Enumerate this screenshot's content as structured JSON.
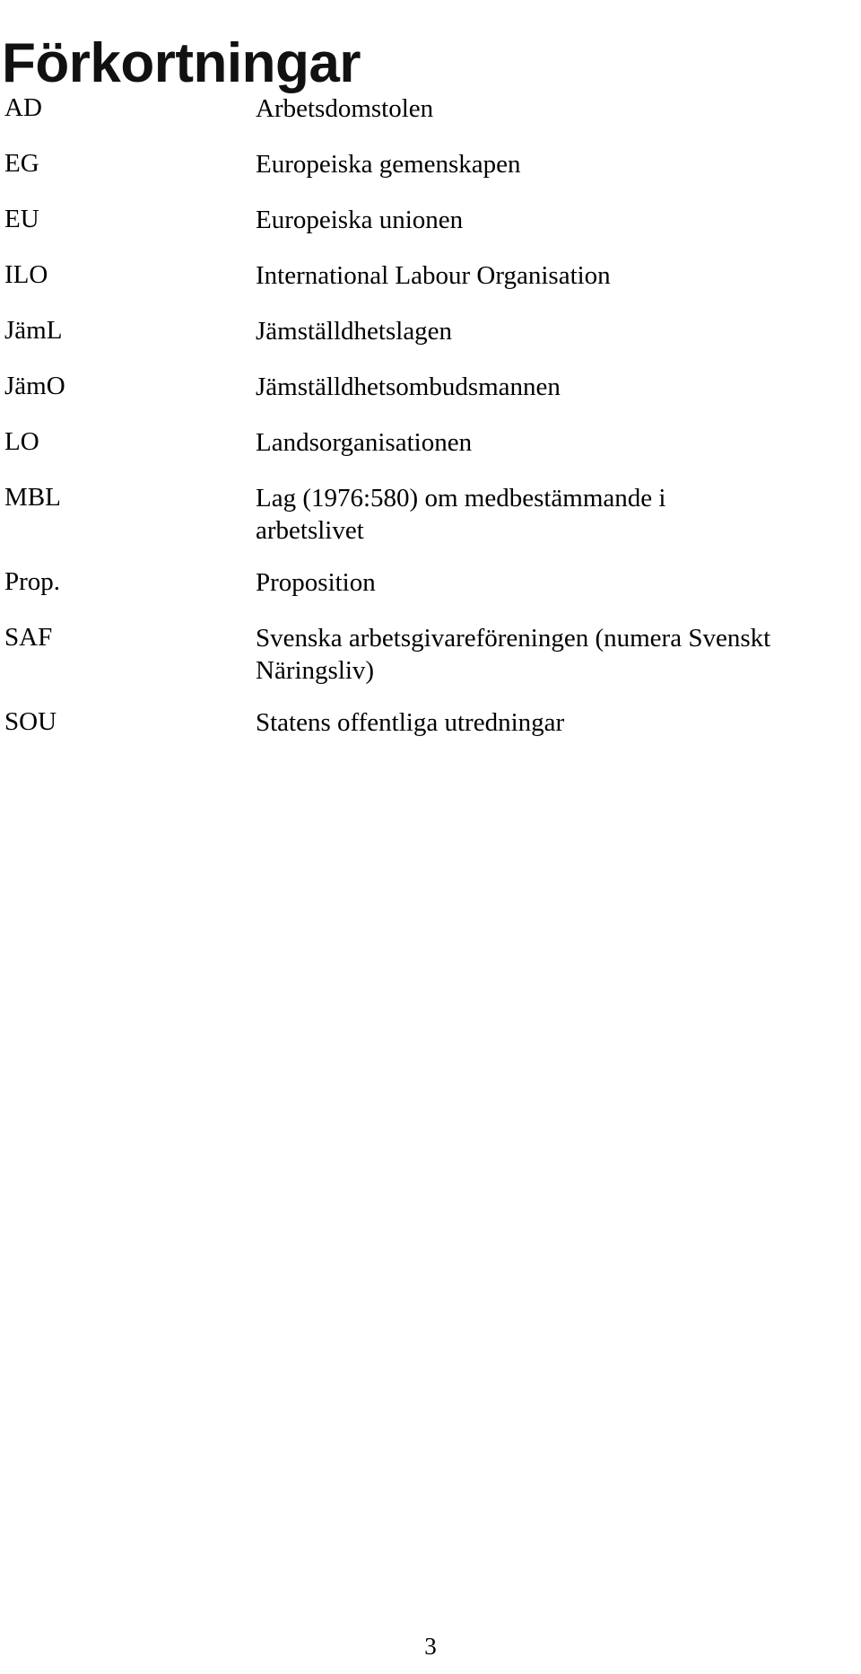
{
  "document": {
    "title": "Förkortningar",
    "page_number": "3"
  },
  "abbreviations": [
    {
      "term": "AD",
      "definition_lines": [
        "Arbetsdomstolen"
      ]
    },
    {
      "term": "EG",
      "definition_lines": [
        "Europeiska gemenskapen"
      ]
    },
    {
      "term": "EU",
      "definition_lines": [
        "Europeiska unionen"
      ]
    },
    {
      "term": "ILO",
      "definition_lines": [
        "International Labour Organisation"
      ]
    },
    {
      "term": "JämL",
      "definition_lines": [
        "Jämställdhetslagen"
      ]
    },
    {
      "term": "JämO",
      "definition_lines": [
        "Jämställdhetsombudsmannen"
      ]
    },
    {
      "term": "LO",
      "definition_lines": [
        "Landsorganisationen"
      ]
    },
    {
      "term": "MBL",
      "definition_lines": [
        "Lag (1976:580) om medbestämmande i",
        "arbetslivet"
      ]
    },
    {
      "term": "Prop.",
      "definition_lines": [
        "Proposition"
      ]
    },
    {
      "term": "SAF",
      "definition_lines": [
        "Svenska arbetsgivareföreningen (numera Svenskt",
        "Näringsliv)"
      ]
    },
    {
      "term": "SOU",
      "definition_lines": [
        "Statens offentliga utredningar"
      ]
    }
  ]
}
